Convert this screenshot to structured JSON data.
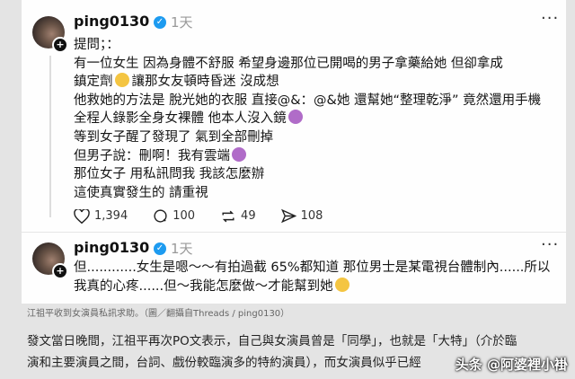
{
  "post1": {
    "username": "ping0130",
    "time": "1天",
    "lines": [
      "提問；：",
      "有一位女生 因為身體不舒服 希望身邊那位已開喝的男子拿藥給她 但卻拿成",
      "鎮定劑",
      "讓那女友頓時昏迷 沒成想",
      "他救她的方法是 脫光她的衣服 直接@&：@&她 還幫她“整理乾淨” 竟然還用手機",
      "全程人錄影全身女裸體 他本人沒入鏡",
      "等到女子醒了發現了 氣到全部刪掉",
      "但男子說：刪啊！我有雲端",
      "那位女子 用私訊問我 我該怎麼辦",
      "這使真實發生的 請重視"
    ],
    "likes": "1,394",
    "comments": "100",
    "reposts": "49",
    "shares": "108"
  },
  "post2": {
    "username": "ping0130",
    "time": "1天",
    "lines": [
      "但............女生是嗯～～有拍過截 65%都知道 那位男士是某電視台體制內......所以",
      "我真的心疼......但～我能怎麼做～才能幫到她"
    ]
  },
  "caption": "江祖平收到女演員私訊求助。（圖／翻攝自Threads / ping0130）",
  "article": [
    "發文當日晚間，江祖平再次PO文表示，自己與女演員曾是「同學」，也就是「大特」（介於臨",
    "演和主要演員之間，台詞、戲份較臨演多的特約演員），而女演員似乎已經"
  ],
  "watermark": "头条 @阿婆裡小褂"
}
